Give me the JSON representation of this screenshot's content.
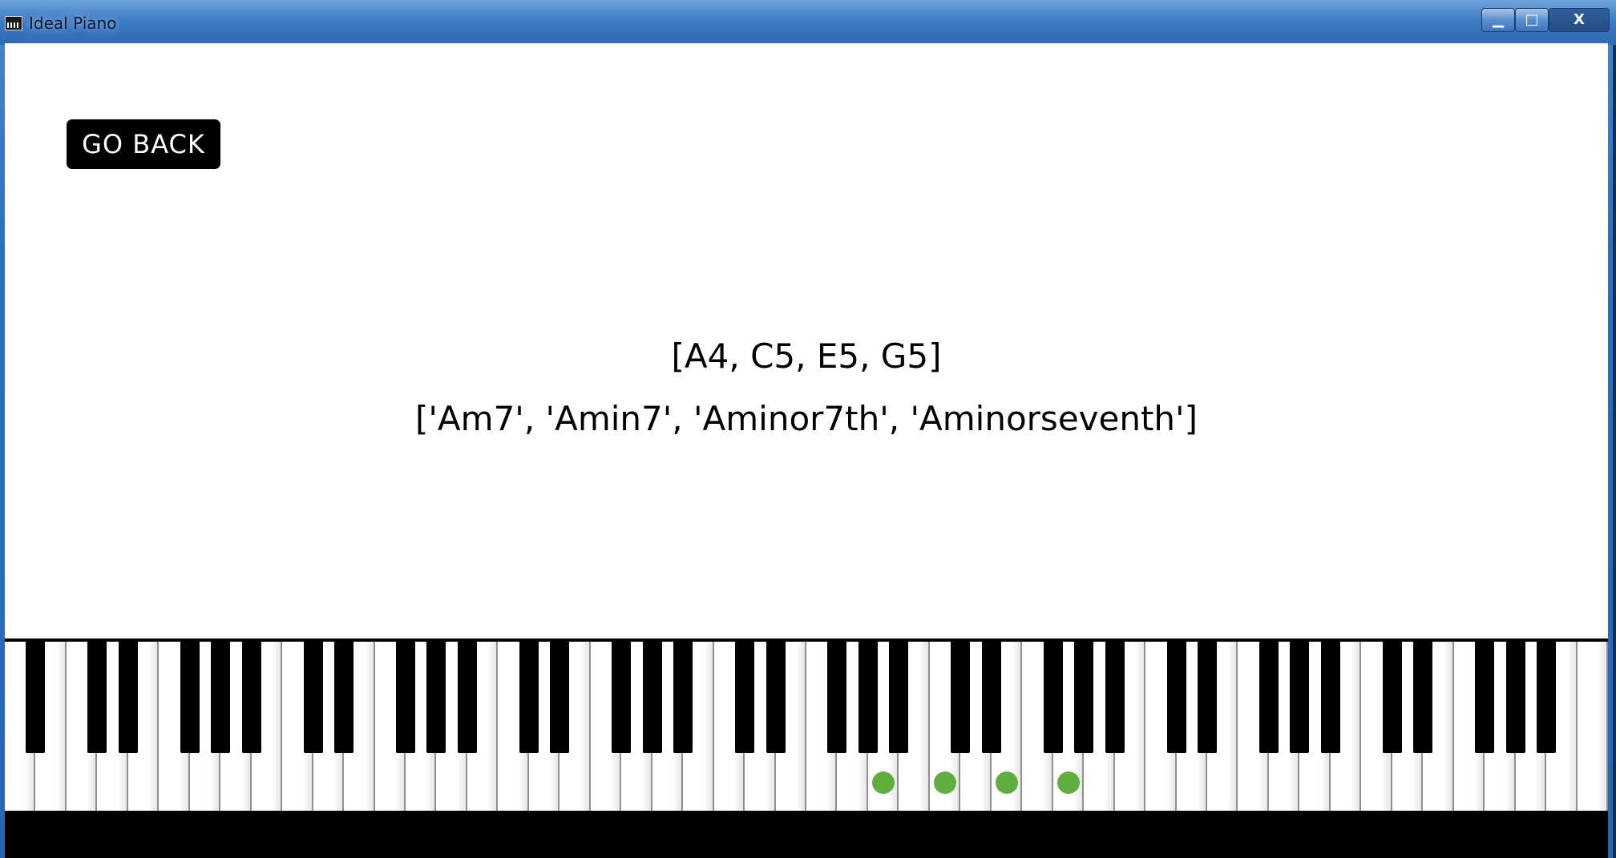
{
  "window": {
    "title": "Ideal Piano",
    "icon": "piano-icon",
    "controls": {
      "minimize_label": "▁",
      "maximize_label": "□",
      "close_label": "X"
    }
  },
  "main": {
    "go_back_label": "GO BACK",
    "notes_text": "[A4, C5, E5, G5]",
    "chord_names_text": "['Am7', 'Amin7', 'Aminor7th', 'Aminorseventh']"
  },
  "keyboard": {
    "white_key_count": 52,
    "highlighted_notes": [
      "A4",
      "C5",
      "E5",
      "G5"
    ],
    "highlight_color": "#5fae3f"
  },
  "colors": {
    "button_bg": "#000000",
    "button_text": "#ffffff",
    "client_bg": "#ffffff",
    "frame": "#2f6db8"
  }
}
